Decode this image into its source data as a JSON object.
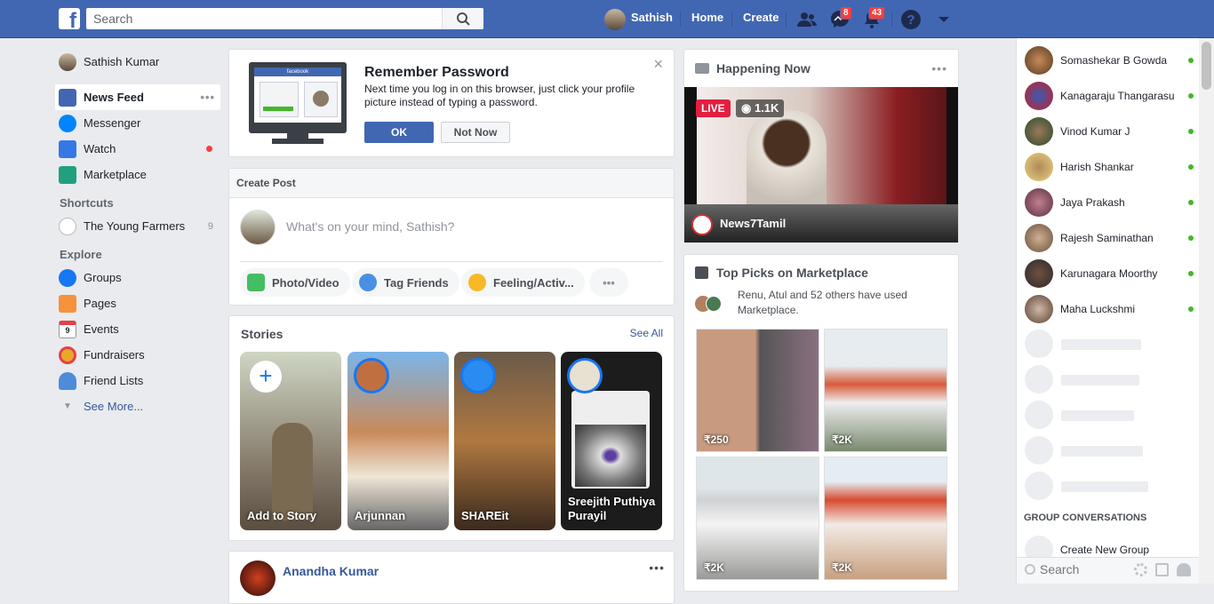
{
  "topbar": {
    "logo": "f",
    "search_placeholder": "Search",
    "user_name": "Sathish",
    "home": "Home",
    "create": "Create",
    "messages_count": "8",
    "notifications_count": "43",
    "colors": {
      "brand": "#4267b2",
      "badge": "#fa3e3e"
    }
  },
  "left_nav": {
    "profile": "Sathish Kumar",
    "items": [
      {
        "label": "News Feed",
        "icon": "news-feed-icon",
        "more": "•••"
      },
      {
        "label": "Messenger",
        "icon": "messenger-icon"
      },
      {
        "label": "Watch",
        "icon": "watch-icon"
      },
      {
        "label": "Marketplace",
        "icon": "marketplace-icon"
      }
    ],
    "shortcuts_heading": "Shortcuts",
    "shortcuts": [
      {
        "label": "The Young Farmers",
        "count": "9"
      }
    ],
    "explore_heading": "Explore",
    "explore": [
      {
        "label": "Groups",
        "icon": "groups-icon"
      },
      {
        "label": "Pages",
        "icon": "pages-flag-icon"
      },
      {
        "label": "Events",
        "icon": "events-calendar-icon",
        "day": "9"
      },
      {
        "label": "Fundraisers",
        "icon": "fundraisers-icon"
      },
      {
        "label": "Friend Lists",
        "icon": "friend-lists-icon"
      }
    ],
    "see_more": "See More..."
  },
  "remember": {
    "title": "Remember Password",
    "body": "Next time you log in on this browser, just click your profile picture instead of typing a password.",
    "ok": "OK",
    "not_now": "Not Now",
    "close": "×",
    "illustration_brand": "facebook"
  },
  "create_post": {
    "heading": "Create Post",
    "placeholder": "What's on your mind, Sathish?",
    "photo_video": "Photo/Video",
    "tag_friends": "Tag Friends",
    "feeling": "Feeling/Activ...",
    "more": "•••"
  },
  "stories": {
    "heading": "Stories",
    "see_all": "See All",
    "items": [
      {
        "label": "Add to Story"
      },
      {
        "label": "Arjunnan"
      },
      {
        "label": "SHAREit"
      },
      {
        "label": "Sreejith Puthiya Purayil"
      }
    ]
  },
  "post": {
    "author": "Anandha Kumar",
    "more": "•••"
  },
  "happening": {
    "title": "Happening Now",
    "more": "•••",
    "live": "LIVE",
    "views": "1.1K",
    "channel": "News7Tamil"
  },
  "marketplace": {
    "title": "Top Picks on Marketplace",
    "social": "Renu, Atul and 52 others have used Marketplace.",
    "items": [
      {
        "price": "₹250"
      },
      {
        "price": "₹2K"
      },
      {
        "price": "₹2K"
      },
      {
        "price": "₹2K"
      }
    ]
  },
  "chat": {
    "contacts": [
      {
        "name": "Somashekar B Gowda"
      },
      {
        "name": "Kanagaraju Thangarasu"
      },
      {
        "name": "Vinod Kumar J"
      },
      {
        "name": "Harish Shankar"
      },
      {
        "name": "Jaya Prakash"
      },
      {
        "name": "Rajesh Saminathan"
      },
      {
        "name": "Karunagara Moorthy"
      },
      {
        "name": "Maha Luckshmi"
      }
    ],
    "group_heading": "GROUP CONVERSATIONS",
    "create_group": "Create New Group",
    "search_placeholder": "Search",
    "online_color": "#42b72a"
  }
}
